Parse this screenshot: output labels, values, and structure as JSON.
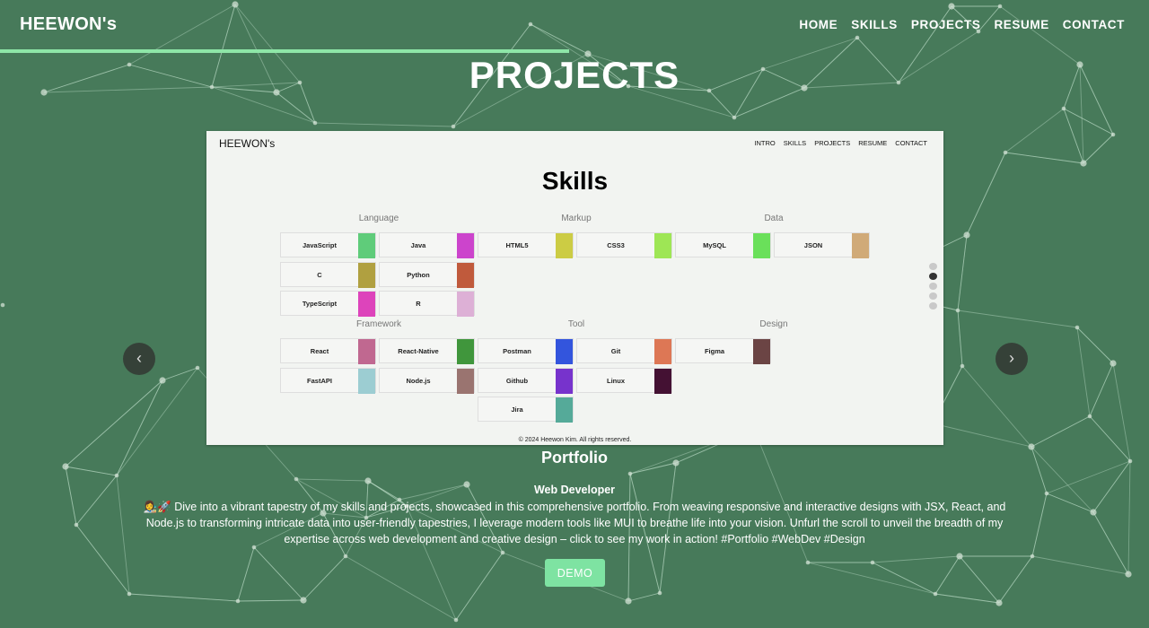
{
  "header": {
    "brand": "HEEWON's",
    "nav": [
      "HOME",
      "SKILLS",
      "PROJECTS",
      "RESUME",
      "CONTACT"
    ],
    "scroll_progress": 0.495
  },
  "section_title": "PROJECTS",
  "carousel": {
    "prev_icon": "chevron-left-icon",
    "next_icon": "chevron-right-icon",
    "screenshot": {
      "brand": "HEEWON's",
      "nav": [
        "INTRO",
        "SKILLS",
        "PROJECTS",
        "RESUME",
        "CONTACT"
      ],
      "title": "Skills",
      "categories": [
        {
          "label": "Language",
          "skills": [
            {
              "name": "JavaScript",
              "color": "#5fcc7a"
            },
            {
              "name": "Java",
              "color": "#cc44cc"
            },
            {
              "name": "C",
              "color": "#b0a040"
            },
            {
              "name": "Python",
              "color": "#c05a3c"
            },
            {
              "name": "TypeScript",
              "color": "#dd44bb"
            },
            {
              "name": "R",
              "color": "#ddb0d6"
            }
          ]
        },
        {
          "label": "Markup",
          "skills": [
            {
              "name": "HTML5",
              "color": "#cccc44"
            },
            {
              "name": "CSS3",
              "color": "#9ee655"
            }
          ]
        },
        {
          "label": "Data",
          "skills": [
            {
              "name": "MySQL",
              "color": "#6ae05a"
            },
            {
              "name": "JSON",
              "color": "#d0aa78"
            }
          ]
        },
        {
          "label": "Framework",
          "skills": [
            {
              "name": "React",
              "color": "#c06890"
            },
            {
              "name": "React-Native",
              "color": "#40963c"
            },
            {
              "name": "FastAPI",
              "color": "#9ccdd2"
            },
            {
              "name": "Node.js",
              "color": "#9a7470"
            }
          ]
        },
        {
          "label": "Tool",
          "skills": [
            {
              "name": "Postman",
              "color": "#3355dd"
            },
            {
              "name": "Git",
              "color": "#dd7755"
            },
            {
              "name": "Github",
              "color": "#7733cc"
            },
            {
              "name": "Linux",
              "color": "#441133"
            },
            {
              "name": "Jira",
              "color": "#55aa99"
            }
          ]
        },
        {
          "label": "Design",
          "skills": [
            {
              "name": "Figma",
              "color": "#6b4444"
            }
          ]
        }
      ],
      "footer": "© 2024 Heewon Kim. All rights reserved.",
      "page_dots_count": 5,
      "active_dot": 1
    }
  },
  "project": {
    "name": "Portfolio",
    "role": "Web Developer",
    "description": "👩‍🎨🚀 Dive into a vibrant tapestry of my skills and projects, showcased in this comprehensive portfolio. From weaving responsive and interactive designs with JSX, React, and Node.js to transforming intricate data into user-friendly tapestries, I leverage modern tools like MUI to breathe life into your vision. Unfurl the scroll to unveil the breadth of my expertise across web development and creative design – click to see my work in action! #Portfolio #WebDev #Design",
    "demo_label": "DEMO"
  },
  "colors": {
    "background": "#477a5a",
    "accent": "#8ee6a8",
    "demo_button": "#7ee3a2"
  }
}
